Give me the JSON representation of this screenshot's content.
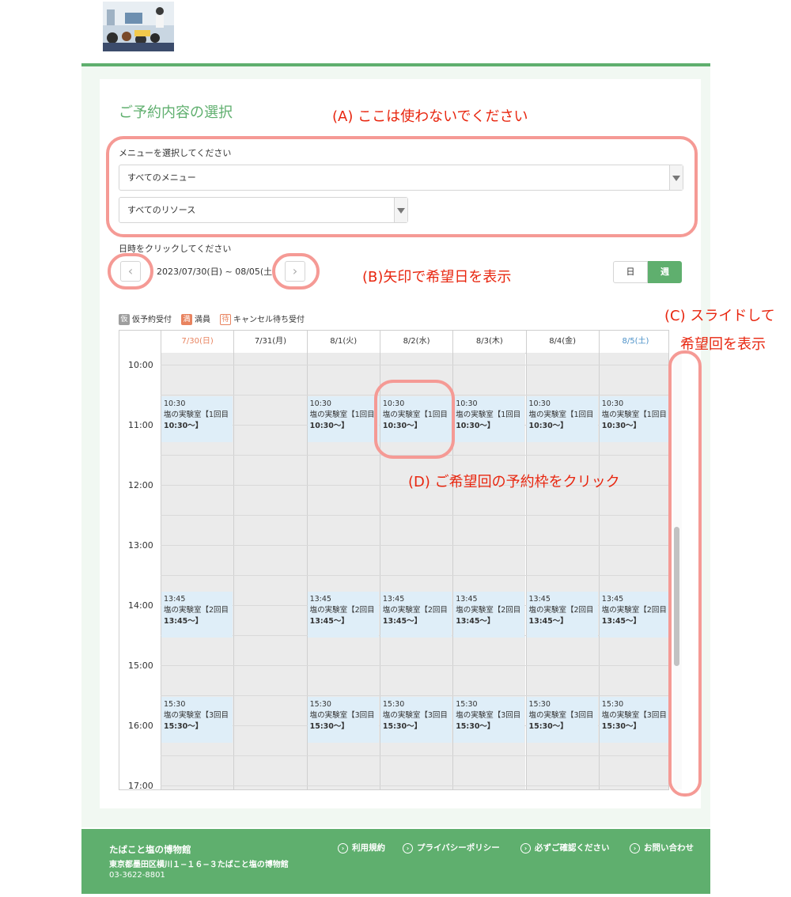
{
  "header": {
    "logo_icon": "museum-audience-photo"
  },
  "form": {
    "section_title": "ご予約内容の選択",
    "menu_label": "メニューを選択してください",
    "menu_value": "すべてのメニュー",
    "resource_value": "すべてのリソース",
    "date_label": "日時をクリックしてください",
    "date_range": "2023/07/30(日) ~ 08/05(土)",
    "prev_icon": "chevron-left-icon",
    "next_icon": "chevron-right-icon",
    "view_day": "日",
    "view_week": "週",
    "active_view": "週"
  },
  "annotations": {
    "a": "(A) ここは使わないでください",
    "b": "(B)矢印で希望日を表示",
    "c1": "(C) スライドして",
    "c2": "希望回を表示",
    "d": "(D) ご希望回の予約枠をクリック"
  },
  "legend": [
    {
      "mark": "仮",
      "label": "仮予約受付",
      "color": "#9e9e9e"
    },
    {
      "mark": "満",
      "label": "満員",
      "color": "#e8835f"
    },
    {
      "mark": "待",
      "label": "キャンセル待ち受付",
      "color": "#e8835f"
    }
  ],
  "calendar": {
    "days": [
      {
        "label": "7/30(日)",
        "color": "#e8835f"
      },
      {
        "label": "7/31(月)",
        "color": "#333333"
      },
      {
        "label": "8/1(火)",
        "color": "#333333"
      },
      {
        "label": "8/2(水)",
        "color": "#333333"
      },
      {
        "label": "8/3(木)",
        "color": "#333333"
      },
      {
        "label": "8/4(金)",
        "color": "#333333"
      },
      {
        "label": "8/5(土)",
        "color": "#4a90c8"
      }
    ],
    "times": [
      "10:00",
      "11:00",
      "12:00",
      "13:00",
      "14:00",
      "15:00",
      "16:00",
      "17:00"
    ],
    "slots": [
      {
        "time": "10:30",
        "title": "塩の実験室【1回目",
        "sub": "10:30〜】",
        "days": [
          0,
          2,
          3,
          4,
          5,
          6
        ]
      },
      {
        "time": "13:45",
        "title": "塩の実験室【2回目",
        "sub": "13:45〜】",
        "days": [
          0,
          2,
          3,
          4,
          5,
          6
        ]
      },
      {
        "time": "15:30",
        "title": "塩の実験室【3回目",
        "sub": "15:30〜】",
        "days": [
          0,
          2,
          3,
          4,
          5,
          6
        ]
      }
    ]
  },
  "footer": {
    "name": "たばこと塩の博物館",
    "address": "東京都墨田区横川１−１６−３たばこと塩の博物館",
    "tel": "03-3622-8801",
    "links": [
      "利用規約",
      "プライバシーポリシー",
      "必ずご確認ください",
      "お問い合わせ"
    ]
  }
}
